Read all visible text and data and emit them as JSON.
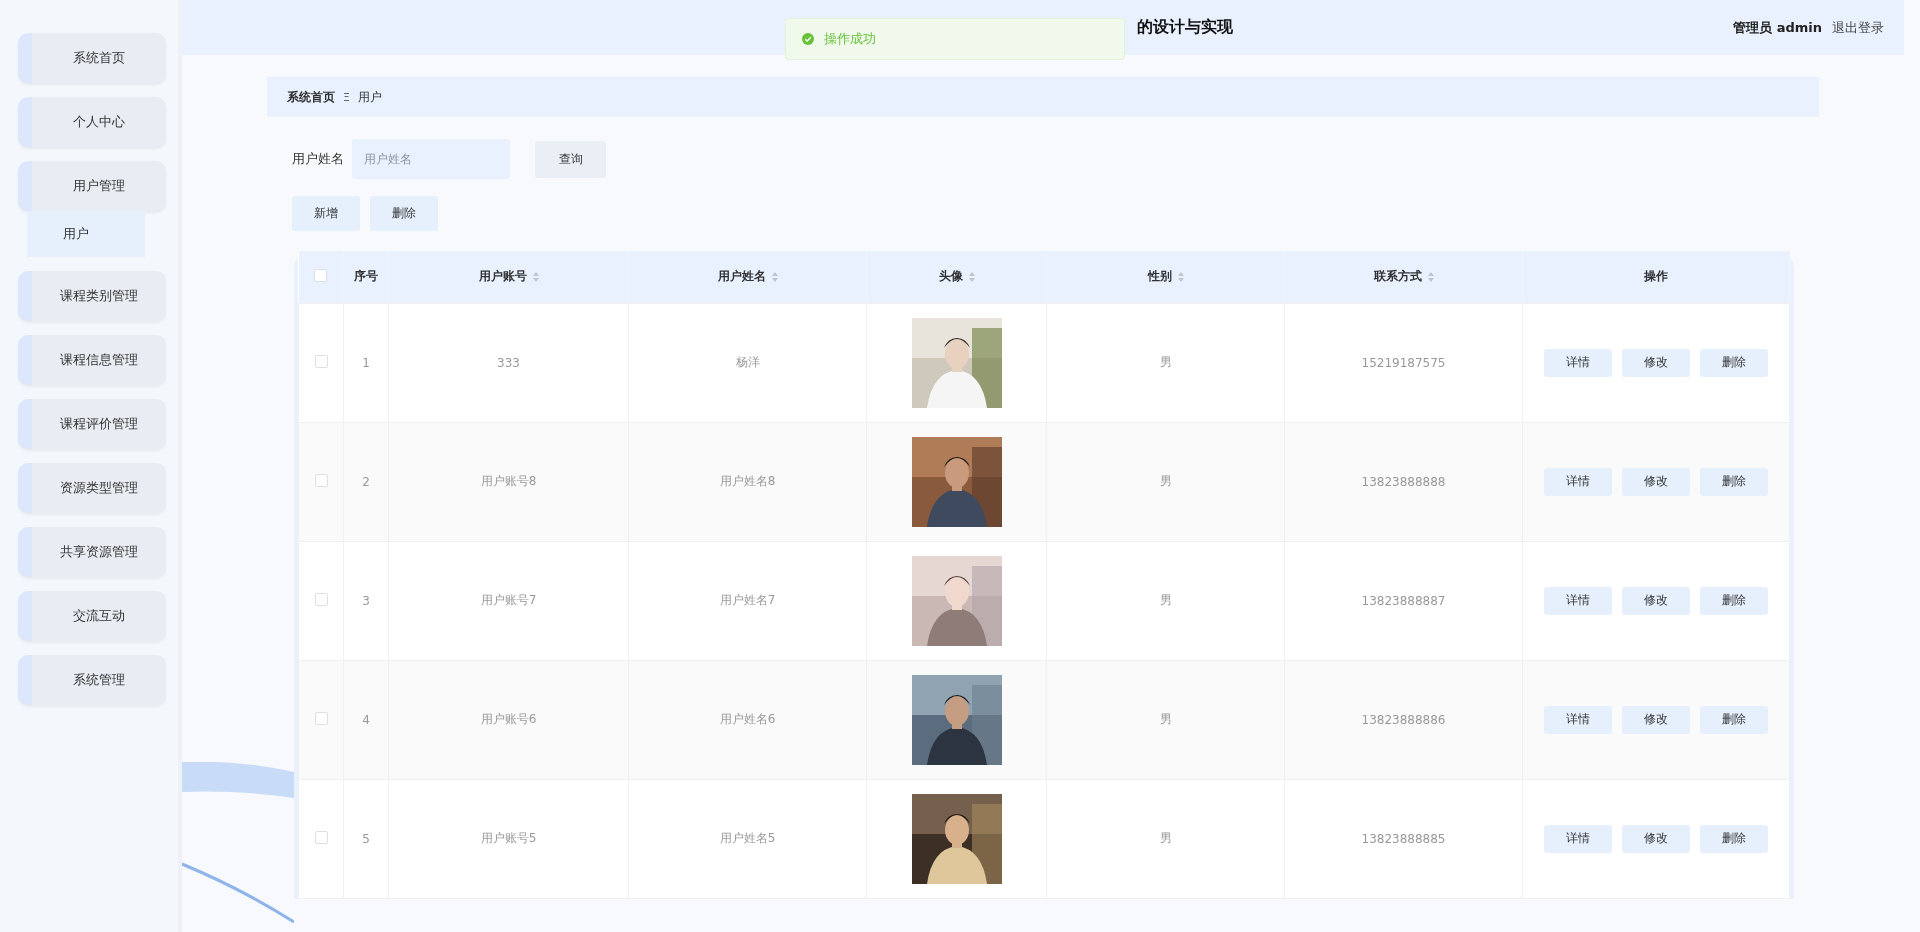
{
  "sidebar": {
    "items": [
      {
        "label": "系统首页"
      },
      {
        "label": "个人中心"
      },
      {
        "label": "用户管理",
        "children": [
          {
            "label": "用户",
            "selected": true
          }
        ]
      },
      {
        "label": "课程类别管理"
      },
      {
        "label": "课程信息管理"
      },
      {
        "label": "课程评价管理"
      },
      {
        "label": "资源类型管理"
      },
      {
        "label": "共享资源管理"
      },
      {
        "label": "交流互动"
      },
      {
        "label": "系统管理"
      }
    ]
  },
  "header": {
    "title": "的设计与实现",
    "user": "管理员 admin",
    "logout": "退出登录"
  },
  "toast": {
    "message": "操作成功"
  },
  "breadcrumb": {
    "home": "系统首页",
    "separator": "Ξ",
    "current": "用户"
  },
  "search": {
    "label": "用户姓名",
    "placeholder": "用户姓名",
    "button": "查询"
  },
  "actions": [
    "新增",
    "删除"
  ],
  "table": {
    "select_all_checked": false,
    "columns": [
      {
        "label": "序号",
        "sortable": false
      },
      {
        "label": "用户账号",
        "sortable": true
      },
      {
        "label": "用户姓名",
        "sortable": true
      },
      {
        "label": "头像",
        "sortable": true
      },
      {
        "label": "性别",
        "sortable": true
      },
      {
        "label": "联系方式",
        "sortable": true
      },
      {
        "label": "操作",
        "sortable": false
      }
    ],
    "rows": [
      {
        "checked": false,
        "index": "1",
        "account": "333",
        "name": "杨洋",
        "gender": "男",
        "phone": "15219187575",
        "buttons": [
          "详情",
          "修改",
          "删除"
        ]
      },
      {
        "checked": false,
        "index": "2",
        "account": "用户账号8",
        "name": "用户姓名8",
        "gender": "男",
        "phone": "13823888888",
        "buttons": [
          "详情",
          "修改",
          "删除"
        ]
      },
      {
        "checked": false,
        "index": "3",
        "account": "用户账号7",
        "name": "用户姓名7",
        "gender": "男",
        "phone": "13823888887",
        "buttons": [
          "详情",
          "修改",
          "删除"
        ]
      },
      {
        "checked": false,
        "index": "4",
        "account": "用户账号6",
        "name": "用户姓名6",
        "gender": "男",
        "phone": "13823888886",
        "buttons": [
          "详情",
          "修改",
          "删除"
        ]
      },
      {
        "checked": false,
        "index": "5",
        "account": "用户账号5",
        "name": "用户姓名5",
        "gender": "男",
        "phone": "13823888885",
        "buttons": [
          "详情",
          "修改",
          "删除"
        ]
      }
    ]
  }
}
